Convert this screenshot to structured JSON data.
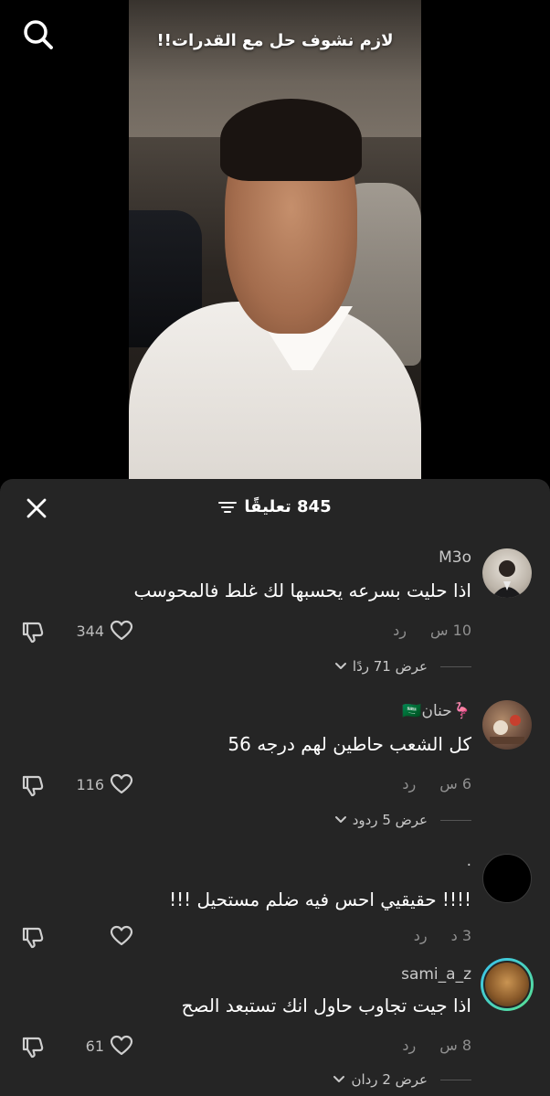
{
  "video": {
    "caption": "لازم نشوف حل مع القدرات!!"
  },
  "comments_header": {
    "title": "845 تعليقًا"
  },
  "comments": [
    {
      "username": "M3o",
      "text": "اذا حليت بسرعه يحسبها لك غلط فالمحوسب",
      "time": "10 س",
      "reply_label": "رد",
      "likes": "344",
      "view_replies": "عرض 71 ردًا"
    },
    {
      "username": "🦩حنان🇸🇦",
      "text": "كل الشعب حاطين لهم درجه 56",
      "time": "6 س",
      "reply_label": "رد",
      "likes": "116",
      "view_replies": "عرض 5 ردود"
    },
    {
      "username": ".",
      "text": "!!!! حقيقيي احس فيه ضلم مستحيل !!!",
      "time": "3 د",
      "reply_label": "رد",
      "likes": "",
      "view_replies": ""
    },
    {
      "username": "sami_a_z",
      "text": "اذا جيت تجاوب حاول انك تستبعد الصح",
      "time": "8 س",
      "reply_label": "رد",
      "likes": "61",
      "view_replies": "عرض 2 ردان"
    }
  ],
  "colors": {
    "sheet_bg": "#252525",
    "muted_text": "#8f8f8f",
    "story_ring": "#39c2f0"
  },
  "icons": {
    "search": "search-icon",
    "close": "close-icon",
    "filter": "filter-icon",
    "like": "heart-icon",
    "dislike": "thumbs-down-icon",
    "expand": "chevron-down-icon"
  }
}
